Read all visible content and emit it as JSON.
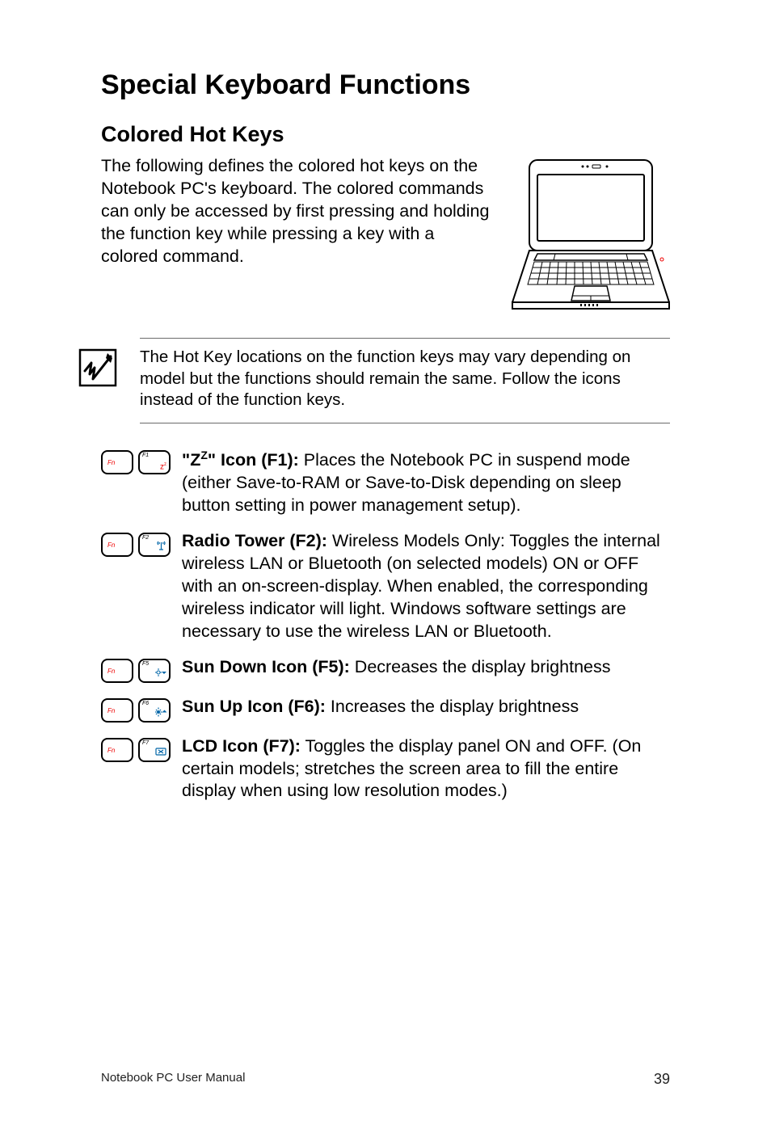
{
  "title": "Special Keyboard Functions",
  "subtitle": "Colored Hot Keys",
  "intro": "The following defines the colored hot keys on the Notebook PC's keyboard. The colored commands can only be accessed by first pressing and holding the function key while pressing a key with a colored command.",
  "note": "The Hot Key locations on the function keys may vary depending on model but the functions should remain the same. Follow the icons instead of the function keys.",
  "hotkeys": {
    "f1": {
      "key_fn": "Fn",
      "key_f": "F1",
      "glyph": "Zᴢ",
      "title": "\"Zᴺ\" Icon (F1):",
      "title_html_pre": "\"Z",
      "title_html_sup": "Z",
      "title_html_post": "\" Icon (F1):",
      "desc": " Places the Notebook PC in suspend mode (either Save-to-RAM or Save-to-Disk depending on sleep button setting in power management setup)."
    },
    "f2": {
      "key_fn": "Fn",
      "key_f": "F2",
      "glyph": "📡",
      "title": "Radio Tower (F2):",
      "desc": " Wireless Models Only: Toggles the internal wireless LAN or Bluetooth (on selected models) ON or OFF with an on-screen-display. When enabled, the corresponding wireless indicator will light. Windows software settings are necessary to use the wireless LAN or Bluetooth."
    },
    "f5": {
      "key_fn": "Fn",
      "key_f": "F5",
      "glyph": "☀▼",
      "title": "Sun Down Icon (F5):",
      "desc": " Decreases the display brightness"
    },
    "f6": {
      "key_fn": "Fn",
      "key_f": "F6",
      "glyph": "☀▲",
      "title": "Sun Up Icon (F6):",
      "desc": " Increases the display brightness"
    },
    "f7": {
      "key_fn": "Fn",
      "key_f": "F7",
      "glyph": "▢⊗",
      "title": "LCD Icon (F7):",
      "desc": " Toggles the display panel ON and OFF. (On certain models; stretches the screen area to fill the entire display when using low resolution modes.)"
    }
  },
  "footer": {
    "left": "Notebook PC User Manual",
    "right": "39"
  }
}
